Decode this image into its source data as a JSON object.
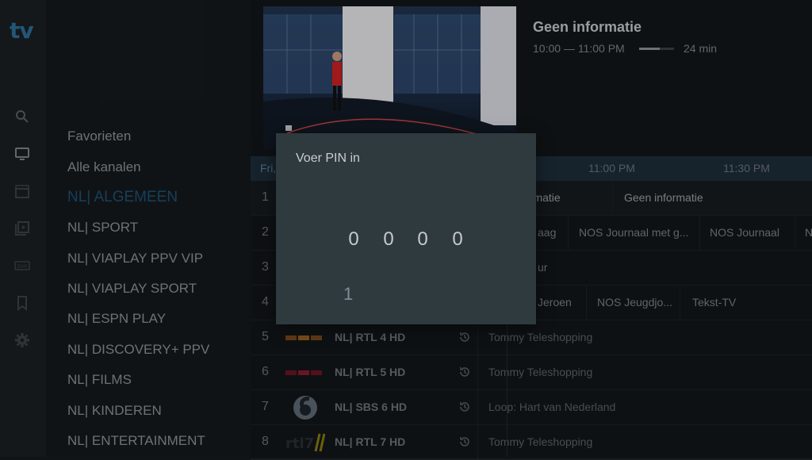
{
  "brand": {
    "logo": "tv",
    "accent": "#2e6f98"
  },
  "sidebar": {
    "icons": [
      "search-icon",
      "tv-icon",
      "movie-clapper-icon",
      "series-play-icon",
      "dvr-icon",
      "bookmark-icon",
      "gear-icon"
    ],
    "dvr_label": "DVR"
  },
  "categories": {
    "items": [
      {
        "label": "Favorieten",
        "active": false
      },
      {
        "label": "Alle kanalen",
        "active": false
      },
      {
        "label": "NL| ALGEMEEN",
        "active": true
      },
      {
        "label": "NL| SPORT",
        "active": false
      },
      {
        "label": "NL| VIAPLAY PPV VIP",
        "active": false
      },
      {
        "label": "NL| VIAPLAY SPORT",
        "active": false
      },
      {
        "label": "NL| ESPN PLAY",
        "active": false
      },
      {
        "label": "NL| DISCOVERY+ PPV",
        "active": false
      },
      {
        "label": "NL| FILMS",
        "active": false
      },
      {
        "label": "NL| KINDEREN",
        "active": false
      },
      {
        "label": "NL| ENTERTAINMENT",
        "active": false
      }
    ]
  },
  "now_playing": {
    "title": "Geen informatie",
    "time": "10:00 — 11:00 PM",
    "progress": 0.6,
    "duration": "24 min"
  },
  "timeline": {
    "day": "Fri,",
    "slots": [
      "11:00 PM",
      "11:30 PM"
    ]
  },
  "channels": [
    {
      "num": "1",
      "name": "",
      "programs": [
        "ormatie",
        "Geen informatie"
      ]
    },
    {
      "num": "2",
      "name": "",
      "programs": [
        "aag",
        "NOS Journaal met g...",
        "NOS Journaal",
        "N"
      ]
    },
    {
      "num": "3",
      "name": "",
      "programs": [
        "ur"
      ]
    },
    {
      "num": "4",
      "name": "",
      "programs": [
        "Jeroen",
        "NOS Jeugdjo...",
        "Tekst-TV"
      ]
    },
    {
      "num": "5",
      "name": "NL| RTL 4 HD",
      "programs": [
        "Tommy Teleshopping"
      ]
    },
    {
      "num": "6",
      "name": "NL| RTL 5 HD",
      "programs": [
        "Tommy Teleshopping"
      ]
    },
    {
      "num": "7",
      "name": "NL| SBS 6 HD",
      "programs": [
        "Loop: Hart van Nederland"
      ]
    },
    {
      "num": "8",
      "name": "NL| RTL 7 HD",
      "programs": [
        "Tommy Teleshopping"
      ]
    }
  ],
  "pin_dialog": {
    "title": "Voer PIN in",
    "digits": [
      "0",
      "0",
      "0",
      "0"
    ],
    "keypad_visible": "1"
  }
}
